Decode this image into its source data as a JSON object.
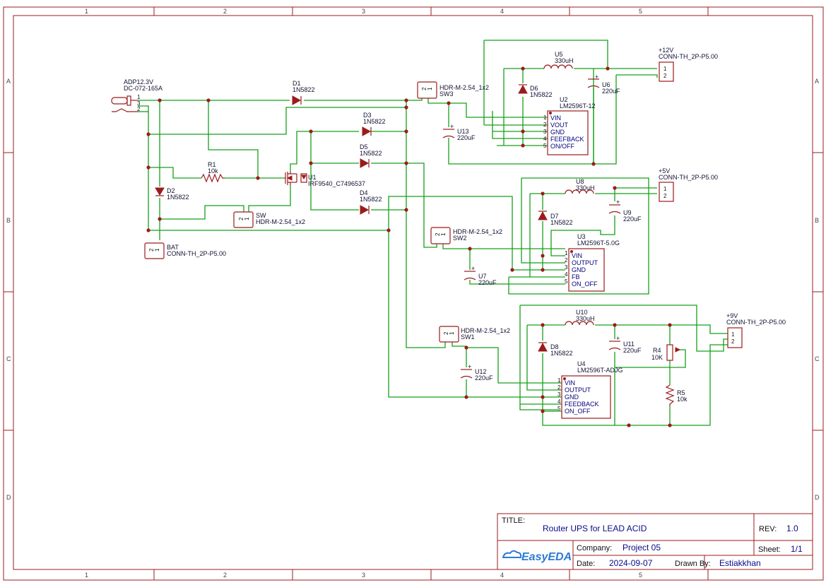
{
  "zones": {
    "cols": [
      "1",
      "2",
      "3",
      "4",
      "5"
    ],
    "rows": [
      "A",
      "B",
      "C",
      "D"
    ]
  },
  "title_block": {
    "title_label": "TITLE:",
    "title_value": "Router UPS for LEAD ACID",
    "rev_label": "REV:",
    "rev_value": "1.0",
    "logo_text": "EasyEDA",
    "company_label": "Company:",
    "company_value": "Project 05",
    "sheet_label": "Sheet:",
    "sheet_value": "1/1",
    "date_label": "Date:",
    "date_value": "2024-09-07",
    "drawn_label": "Drawn By:",
    "drawn_value": "Estiakkhan"
  },
  "components": {
    "adp": {
      "name": "ADP12.3V",
      "value": "DC-072-165A",
      "pins": [
        "1",
        "3",
        "2"
      ]
    },
    "d1": {
      "name": "D1",
      "value": "1N5822"
    },
    "d2": {
      "name": "D2",
      "value": "1N5822"
    },
    "d3": {
      "name": "D3",
      "value": "1N5822"
    },
    "d4": {
      "name": "D4",
      "value": "1N5822"
    },
    "d5": {
      "name": "D5",
      "value": "1N5822"
    },
    "d6": {
      "name": "D6",
      "value": "1N5822"
    },
    "d7": {
      "name": "D7",
      "value": "1N5822"
    },
    "d8": {
      "name": "D8",
      "value": "1N5822"
    },
    "r1": {
      "name": "R1",
      "value": "10k"
    },
    "r4": {
      "name": "R4",
      "value": "10K"
    },
    "r5": {
      "name": "R5",
      "value": "10k"
    },
    "u1": {
      "name": "U1",
      "value": "IRF9540_C7496537"
    },
    "sw": {
      "name": "SW",
      "value": "HDR-M-2.54_1x2"
    },
    "sw1": {
      "name": "SW1",
      "value": "HDR-M-2.54_1x2"
    },
    "sw2": {
      "name": "SW2",
      "value": "HDR-M-2.54_1x2"
    },
    "sw3": {
      "name": "SW3",
      "value": "HDR-M-2.54_1x2"
    },
    "bat": {
      "name": "BAT",
      "value": "CONN-TH_2P-P5.00"
    },
    "out12": {
      "name": "+12V",
      "value": "CONN-TH_2P-P5.00"
    },
    "out5": {
      "name": "+5V",
      "value": "CONN-TH_2P-P5.00"
    },
    "out9": {
      "name": "+9V",
      "value": "CONN-TH_2P-P5.00"
    },
    "u5": {
      "name": "U5",
      "value": "330uH"
    },
    "u8": {
      "name": "U8",
      "value": "330uH"
    },
    "u10": {
      "name": "U10",
      "value": "330uH"
    },
    "u6": {
      "name": "U6",
      "value": "220uF"
    },
    "u9": {
      "name": "U9",
      "value": "220uF"
    },
    "u11": {
      "name": "U11",
      "value": "220uF"
    },
    "u7": {
      "name": "U7",
      "value": "220uF"
    },
    "u12": {
      "name": "U12",
      "value": "220uF"
    },
    "u13": {
      "name": "U13",
      "value": "220uF"
    },
    "u2": {
      "name": "U2",
      "value": "LM2596T-12",
      "pins": [
        "VIN",
        "VOUT",
        "GND",
        "FEEFBACK",
        "ON/OFF"
      ]
    },
    "u3": {
      "name": "U3",
      "value": "LM2596T-5.0G",
      "pins": [
        "VIN",
        "OUTPUT",
        "GND",
        "FB",
        "ON_OFF"
      ]
    },
    "u4": {
      "name": "U4",
      "value": "LM2596T-ADJG",
      "pins": [
        "VIN",
        "OUTPUT",
        "GND",
        "FEEDBACK",
        "ON_OFF"
      ]
    }
  },
  "colors": {
    "frame": "#9b1c1c",
    "wire": "#16a01a",
    "text": "#00007a"
  }
}
